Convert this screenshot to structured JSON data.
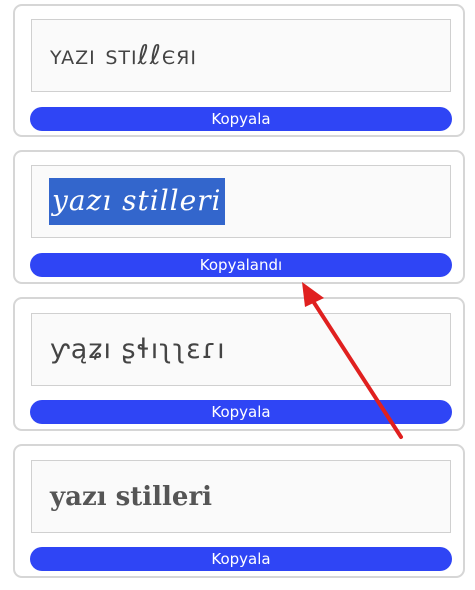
{
  "cards": [
    {
      "text": "yazı sтιℓℓєяι",
      "button": "Kopyala"
    },
    {
      "text": "yazı stilleri",
      "button": "Kopyalandı"
    },
    {
      "text": "ƴąʑı ʂɬıʅʅɛɾı",
      "button": "Kopyala"
    },
    {
      "text": "yazı stilleri",
      "button": "Kopyala"
    }
  ],
  "colors": {
    "button_bg": "#2f45f5",
    "selection_bg": "#3366cc",
    "arrow": "#e0201f"
  }
}
